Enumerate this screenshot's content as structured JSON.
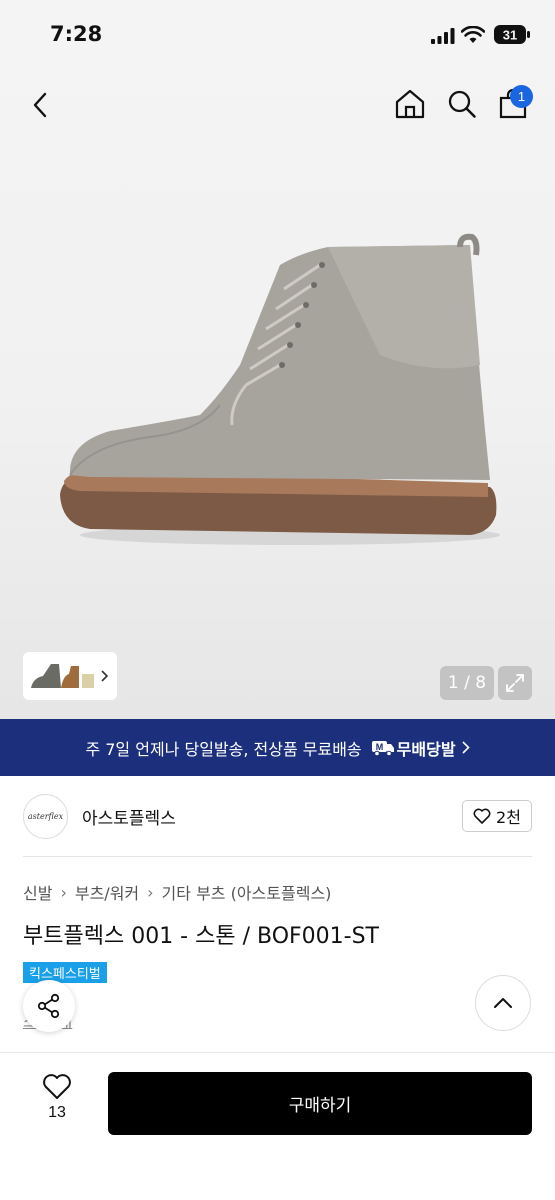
{
  "status_bar": {
    "time": "7:28",
    "battery": "31"
  },
  "header": {
    "cart_count": "1"
  },
  "gallery": {
    "counter": "1 / 8"
  },
  "banner": {
    "text": "주 7일 언제나 당일발송, 전상품 무료배송",
    "logo_text": "무배당발",
    "logo_mark": "M"
  },
  "brand": {
    "name": "아스토플렉스",
    "logo_text": "asterflex",
    "likes": "2천"
  },
  "breadcrumb": [
    "신발",
    "부츠/워커",
    "기타 부츠 (아스토플렉스)"
  ],
  "product": {
    "title": "부트플렉스 001 - 스톤 / BOF001-ST",
    "event_badge": "킥스페스티벌",
    "partial_link": "스토 매"
  },
  "bottom_bar": {
    "wish_count": "13",
    "buy_label": "구매하기"
  },
  "colors": {
    "banner": "#1b2f7d",
    "badge": "#1a66e0",
    "event": "#1aa0e8",
    "buy": "#000000"
  },
  "icons": [
    "back-icon",
    "home-icon",
    "search-icon",
    "shopping-bag-icon",
    "chevron-right-icon",
    "expand-icon",
    "heart-icon",
    "share-icon",
    "chevron-up-icon"
  ]
}
